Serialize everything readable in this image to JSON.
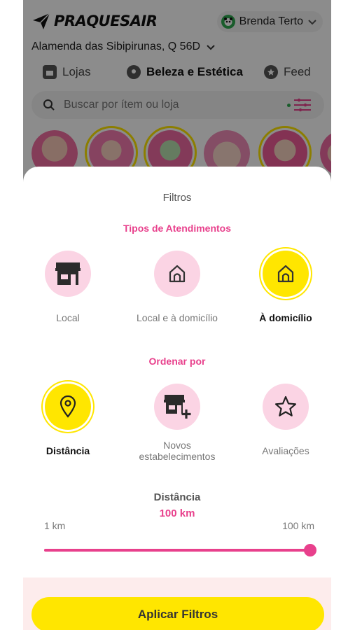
{
  "header": {
    "brand": "PRAQUESAIR",
    "user_name": "Brenda Terto",
    "address": "Alamenda das Sibipirunas, Q 56D"
  },
  "nav_tabs": [
    {
      "label": "Lojas",
      "icon": "store-icon"
    },
    {
      "label": "Beleza e Estética",
      "icon": "beauty-icon",
      "active": true
    },
    {
      "label": "Feed",
      "icon": "star-icon"
    }
  ],
  "search": {
    "placeholder": "Buscar por ítem ou loja"
  },
  "filters": {
    "title": "Filtros",
    "attendance": {
      "title": "Tipos de Atendimentos",
      "options": [
        {
          "label": "Local",
          "icon": "store-icon",
          "selected": false
        },
        {
          "label": "Local e à domicílio",
          "icon": "house-icon",
          "selected": false
        },
        {
          "label": "À domicílio",
          "icon": "house-icon",
          "selected": true
        }
      ]
    },
    "order": {
      "title": "Ordenar por",
      "options": [
        {
          "label": "Distância",
          "icon": "location-pin-icon",
          "selected": true
        },
        {
          "label": "Novos estabelecimentos",
          "icon": "store-add-icon",
          "selected": false
        },
        {
          "label": "Avaliações",
          "icon": "star-outline-icon",
          "selected": false
        }
      ]
    },
    "distance": {
      "title": "Distância",
      "value": "100 km",
      "min_label": "1 km",
      "max_label": "100 km",
      "min": 1,
      "max": 100,
      "current": 100
    },
    "apply_label": "Aplicar Filtros"
  },
  "colors": {
    "accent_yellow": "#ffe600",
    "accent_pink": "#e8408c",
    "pink_light": "#fbd4e4"
  }
}
